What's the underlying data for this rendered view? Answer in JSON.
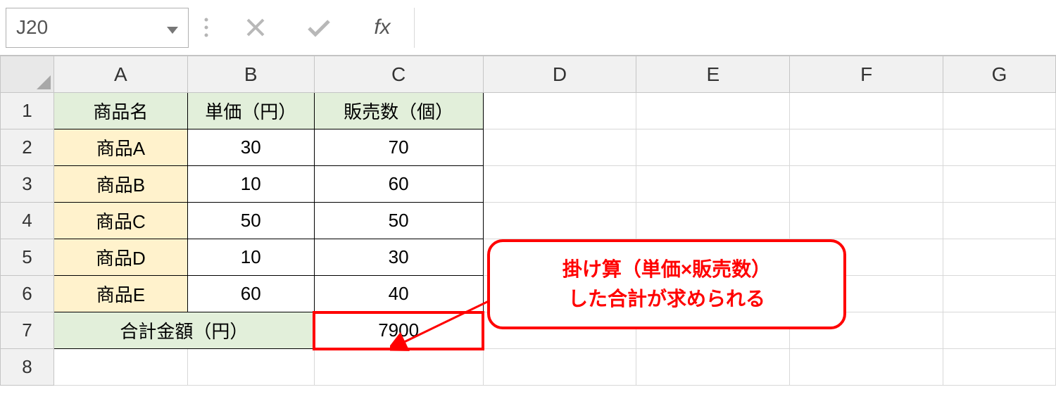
{
  "formula_bar": {
    "name_box": "J20",
    "cancel_icon": "✕",
    "enter_icon": "✓",
    "fx_label": "fx",
    "formula": ""
  },
  "columns": [
    "A",
    "B",
    "C",
    "D",
    "E",
    "F",
    "G"
  ],
  "rows": [
    "1",
    "2",
    "3",
    "4",
    "5",
    "6",
    "7",
    "8"
  ],
  "headers": {
    "A1": "商品名",
    "B1": "単価（円）",
    "C1": "販売数（個）"
  },
  "products": [
    {
      "name": "商品A",
      "price": "30",
      "qty": "70"
    },
    {
      "name": "商品B",
      "price": "10",
      "qty": "60"
    },
    {
      "name": "商品C",
      "price": "50",
      "qty": "50"
    },
    {
      "name": "商品D",
      "price": "10",
      "qty": "30"
    },
    {
      "name": "商品E",
      "price": "60",
      "qty": "40"
    }
  ],
  "total": {
    "label": "合計金額（円）",
    "value": "7900"
  },
  "callout": {
    "line1": "掛け算（単価×販売数）",
    "line2": "した合計が求められる"
  },
  "chart_data": {
    "type": "table",
    "columns": [
      "商品名",
      "単価（円）",
      "販売数（個）"
    ],
    "rows": [
      [
        "商品A",
        30,
        70
      ],
      [
        "商品B",
        10,
        60
      ],
      [
        "商品C",
        50,
        50
      ],
      [
        "商品D",
        10,
        30
      ],
      [
        "商品E",
        60,
        40
      ]
    ],
    "total_label": "合計金額（円）",
    "total_value": 7900
  }
}
